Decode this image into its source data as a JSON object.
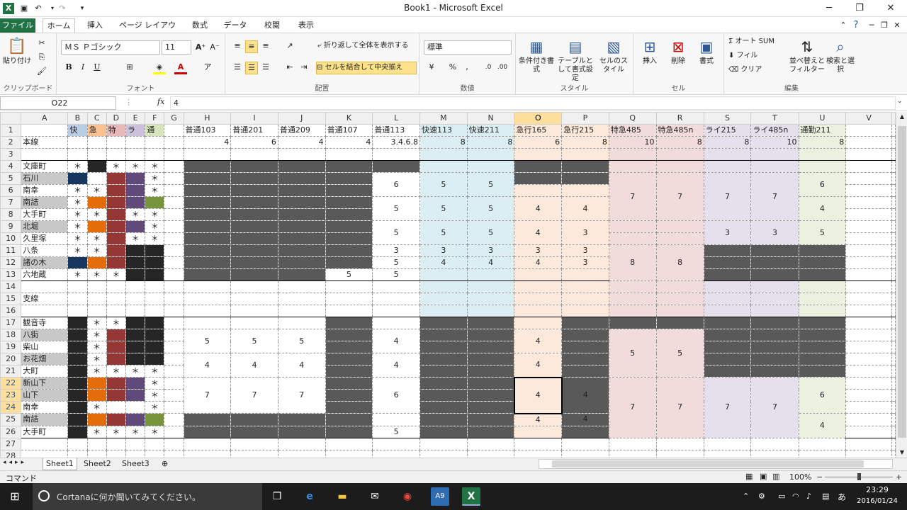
{
  "title": "Book1 - Microsoft Excel",
  "tabs": [
    "ファイル",
    "ホーム",
    "挿入",
    "ページ レイアウト",
    "数式",
    "データ",
    "校閲",
    "表示"
  ],
  "ribbon": {
    "paste": "貼り付け",
    "clipboard_label": "クリップボード",
    "font_name": "ＭＳ Ｐゴシック",
    "font_size": "11",
    "font_label": "フォント",
    "wrap_text": "折り返して全体を表示する",
    "merge_center": "セルを結合して中央揃え",
    "align_label": "配置",
    "number_format": "標準",
    "number_label": "数値",
    "cond_format": "条件付き書式",
    "format_table": "テーブルとして書式設定",
    "cell_styles": "セルのスタイル",
    "style_label": "スタイル",
    "insert": "挿入",
    "delete": "削除",
    "format": "書式",
    "cells_label": "セル",
    "autosum": "オート SUM",
    "fill": "フィル",
    "clear": "クリア",
    "sort_filter": "並べ替えとフィルター",
    "find_select": "検索と選択",
    "edit_label": "編集"
  },
  "formula_bar": {
    "name_box": "O22",
    "fx": "fx",
    "value": "4"
  },
  "columns": [
    "A",
    "B",
    "C",
    "D",
    "E",
    "F",
    "G",
    "H",
    "I",
    "J",
    "K",
    "L",
    "M",
    "N",
    "O",
    "P",
    "Q",
    "R",
    "S",
    "T",
    "U",
    "V"
  ],
  "selected_column": "O",
  "row1": [
    "",
    "快",
    "急",
    "特",
    "ラ",
    "通",
    "",
    "普通103",
    "普通201",
    "普通209",
    "普通107",
    "普通113",
    "快速113",
    "快速211",
    "急行165",
    "急行215",
    "特急485",
    "特急485n",
    "ライ215",
    "ライ485n",
    "通勤211",
    ""
  ],
  "row2": [
    "本線",
    "",
    "",
    "",
    "",
    "",
    "",
    "4",
    "6",
    "4",
    "4",
    "3.4.6.8",
    "8",
    "8",
    "6",
    "8",
    "10",
    "8",
    "8",
    "10",
    "8",
    ""
  ],
  "station_names": {
    "4": "文庫町",
    "5": "石川",
    "6": "南幸",
    "7": "南詰",
    "8": "大手町",
    "9": "北堀",
    "10": "久里塚",
    "11": "八条",
    "12": "諸の木",
    "13": "六地蔵",
    "15": "支線",
    "17": "観音寺",
    "18": "八街",
    "19": "柴山",
    "20": "お花畑",
    "21": "大町",
    "22": "新山下",
    "23": "山下",
    "24": "南幸",
    "25": "南詰",
    "26": "大手町"
  },
  "marker": "＊",
  "sheets": [
    "Sheet1",
    "Sheet2",
    "Sheet3"
  ],
  "status": {
    "mode": "コマンド",
    "zoom": "100%"
  },
  "taskbar": {
    "search": "Cortanaに何か聞いてみてください。",
    "time": "23:29",
    "date": "2016/01/24",
    "ime": "あ"
  },
  "colors": {
    "excel_green": "#217346",
    "dark": "#595959",
    "black": "#262626",
    "navy": "#17375e",
    "orange": "#e46c0a",
    "red": "#953735",
    "purple": "#604a7b",
    "green": "#77933c",
    "lightblue": "#dbeef4",
    "peach": "#fde9d9",
    "pink": "#f2dcdb",
    "lavender": "#e5e0ec",
    "lightgreen": "#ebf1de"
  }
}
